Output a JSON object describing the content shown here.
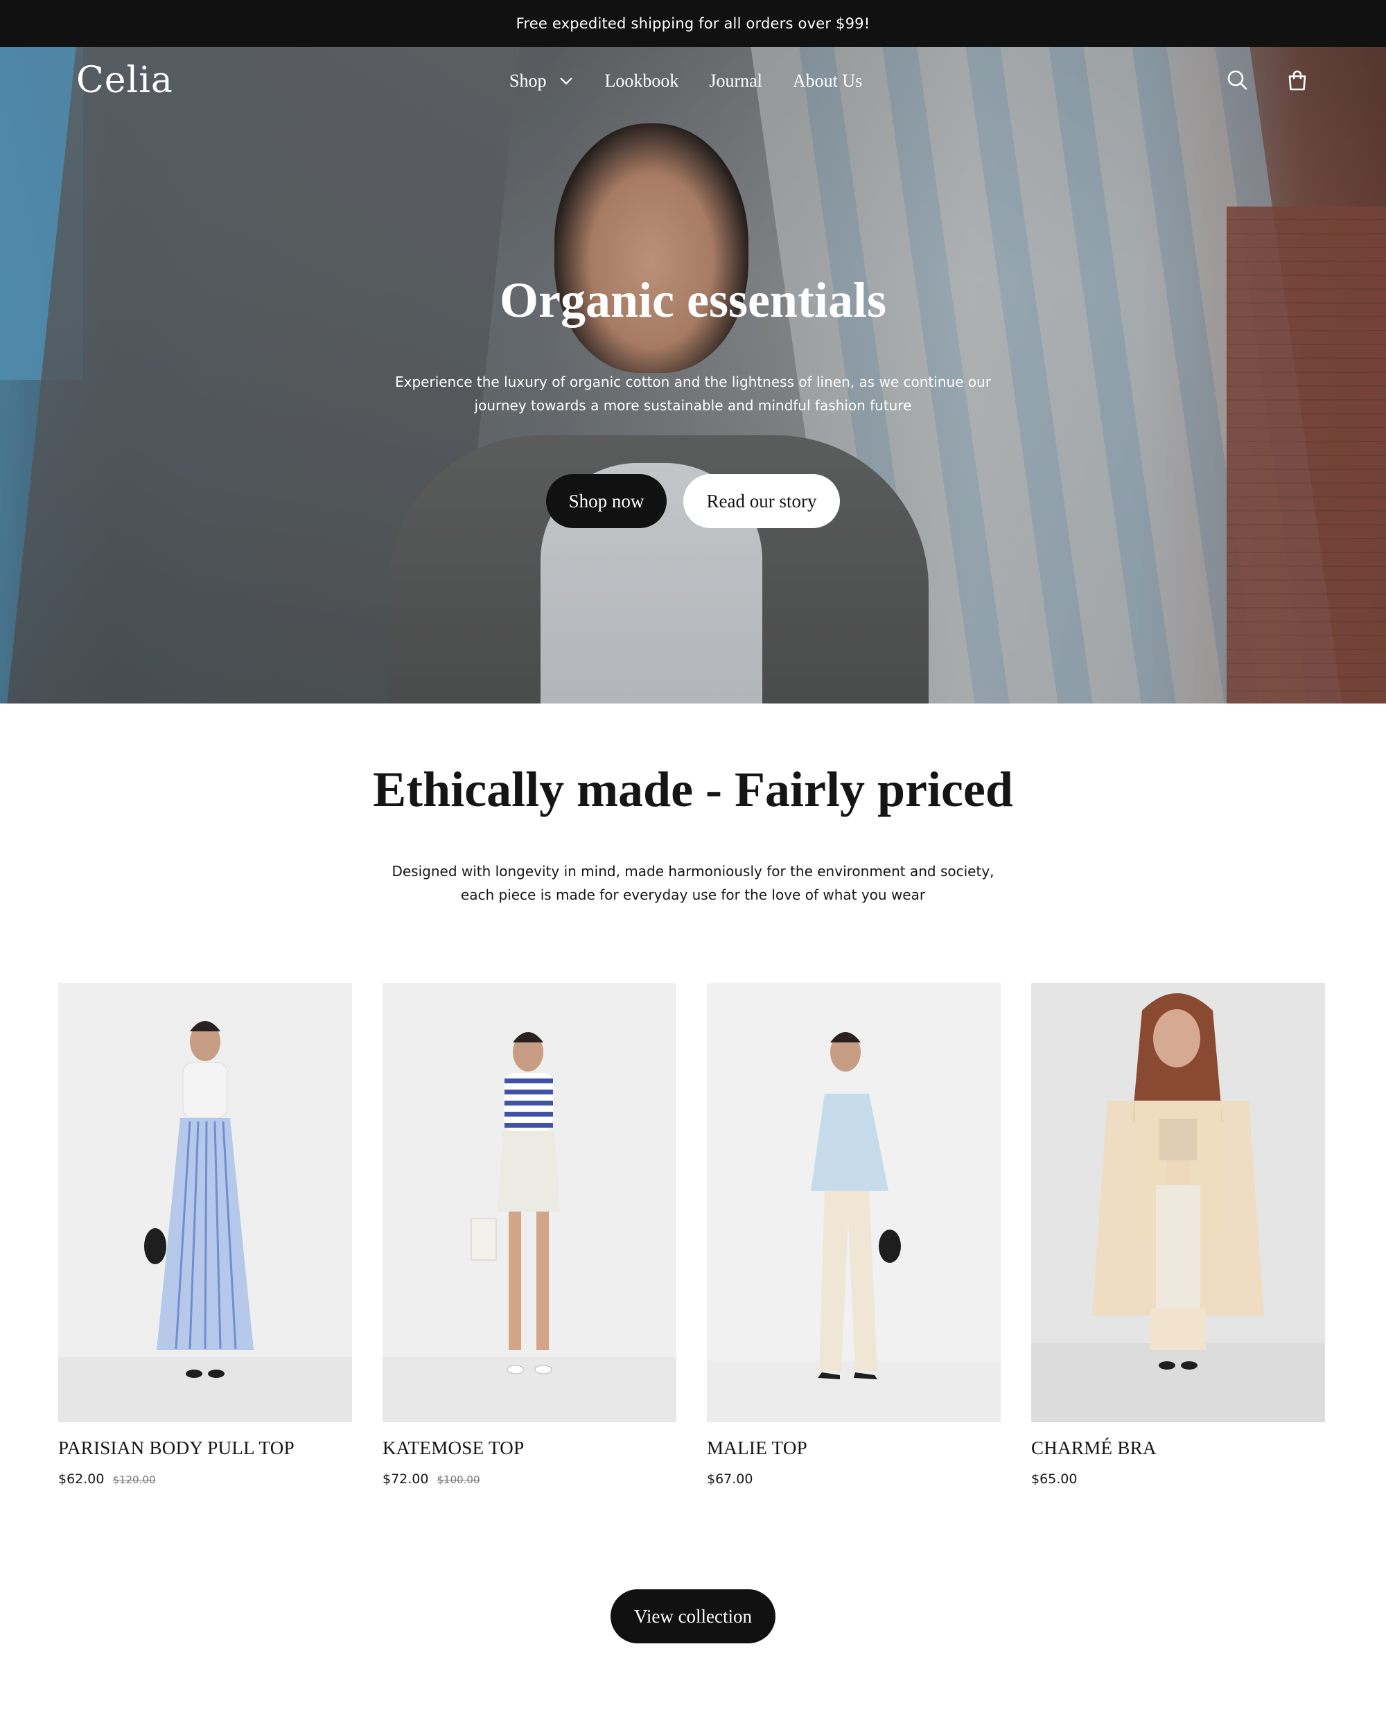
{
  "announcement": {
    "text": "Free expedited shipping for all orders over $99!"
  },
  "header": {
    "logo": "Celia",
    "nav": [
      {
        "label": "Shop",
        "has_dropdown": true
      },
      {
        "label": "Lookbook"
      },
      {
        "label": "Journal"
      },
      {
        "label": "About Us"
      }
    ],
    "icons": [
      "search-icon",
      "shopping-bag-icon"
    ]
  },
  "hero": {
    "title": "Organic essentials",
    "subtitle": "Experience the luxury of organic cotton and the lightness of linen, as we continue our journey towards a more sustainable and mindful fashion future",
    "primary_button": "Shop now",
    "secondary_button": "Read our story"
  },
  "featured": {
    "title": "Ethically made - Fairly priced",
    "subtitle": "Designed with longevity in mind, made harmoniously for the environment and society, each piece is made for everyday use for the love of what you wear",
    "products": [
      {
        "name": "PARISIAN BODY PULL TOP",
        "price": "$62.00",
        "compare_price": "$120.00"
      },
      {
        "name": "KATEMOSE TOP",
        "price": "$72.00",
        "compare_price": "$100.00"
      },
      {
        "name": "MALIE TOP",
        "price": "$67.00",
        "compare_price": ""
      },
      {
        "name": "CHARMÉ BRA",
        "price": "$65.00",
        "compare_price": ""
      }
    ],
    "view_button": "View collection"
  },
  "colors": {
    "dark": "#111111",
    "text": "#151515",
    "muted": "#777777",
    "background": "#ffffff"
  }
}
